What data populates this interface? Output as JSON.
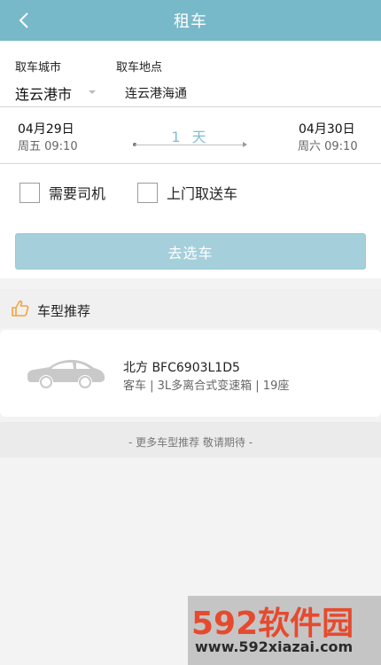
{
  "header": {
    "title": "租车",
    "back_icon": "chevron-left-icon"
  },
  "location": {
    "city_label": "取车城市",
    "address_label": "取车地点",
    "city_value": "连云港市",
    "address_value": "连云港海通"
  },
  "dates": {
    "pickup_date": "04月29日",
    "pickup_time": "周五 09:10",
    "return_date": "04月30日",
    "return_time": "周六 09:10",
    "duration": "1 天"
  },
  "options": [
    {
      "label": "需要司机",
      "checked": false
    },
    {
      "label": "上门取送车",
      "checked": false
    }
  ],
  "submit_label": "去选车",
  "recommend": {
    "title": "车型推荐",
    "icon": "thumbs-up-icon",
    "car": {
      "name": "北方 BFC6903L1D5",
      "spec": "客车 | 3L多离合式变速箱 | 19座",
      "icon": "car-icon"
    },
    "more_text": "- 更多车型推荐 敬请期待 -"
  },
  "watermark": {
    "brand": "592软件园",
    "url": "www.592xiazai.com"
  },
  "colors": {
    "header": "#78b9c9",
    "button": "#a5cfdb",
    "accent_text": "#7fbfd1",
    "icon_orange": "#f5a340"
  }
}
